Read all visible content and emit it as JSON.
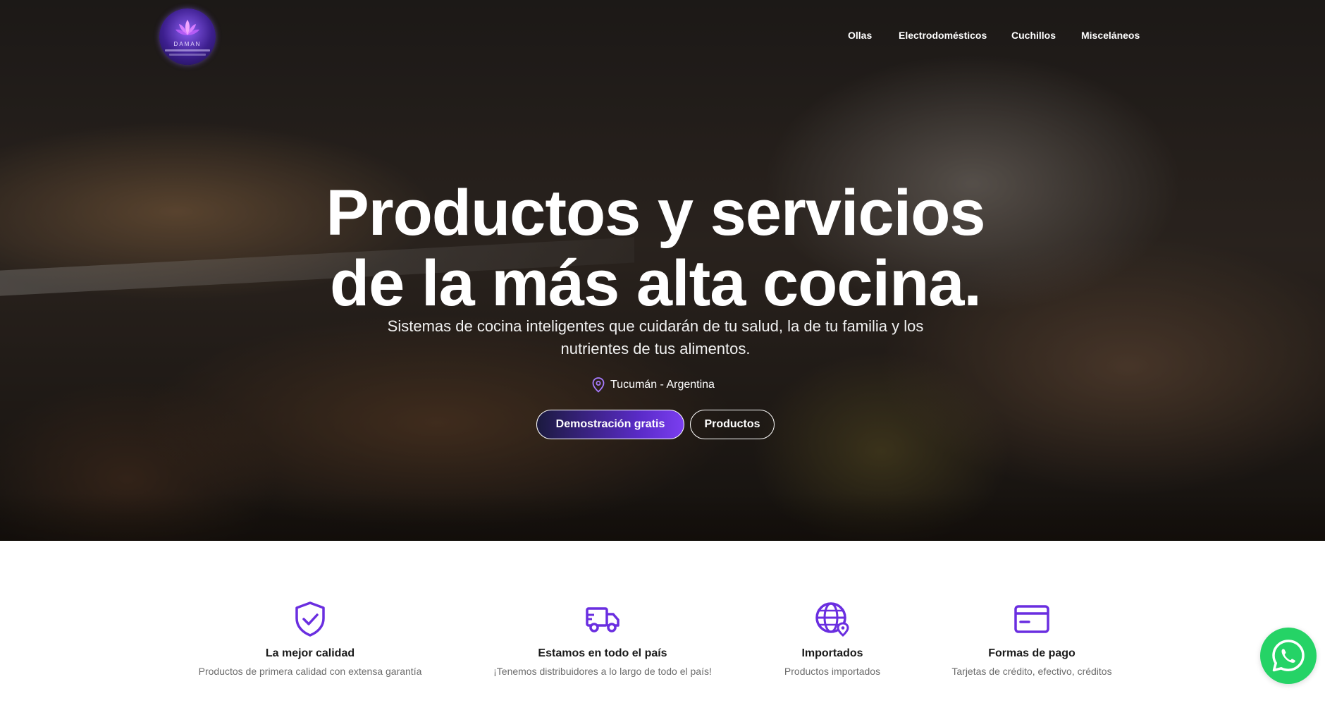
{
  "brand": {
    "logo_text": "DAMAN",
    "accent_color": "#6a2ee0"
  },
  "nav": {
    "items": [
      {
        "label": "Ollas"
      },
      {
        "label": "Electrodomésticos"
      },
      {
        "label": "Cuchillos"
      },
      {
        "label": "Misceláneos"
      }
    ]
  },
  "hero": {
    "headline_line1": "Productos y servicios",
    "headline_line2": "de la más alta cocina.",
    "subtext_line1": "Sistemas de cocina inteligentes que cuidarán de tu salud, la de tu familia y los",
    "subtext_line2": "nutrientes de tus alimentos.",
    "location": "Tucumán - Argentina",
    "location_icon": "map-pin-icon",
    "primary_button": "Demostración gratis",
    "secondary_button": "Productos"
  },
  "features": [
    {
      "icon": "shield-check-icon",
      "title": "La mejor calidad",
      "description": "Productos de primera calidad con extensa garantía"
    },
    {
      "icon": "truck-icon",
      "title": "Estamos en todo el país",
      "description": "¡Tenemos distribuidores a lo largo de todo el país!"
    },
    {
      "icon": "globe-location-icon",
      "title": "Importados",
      "description": "Productos importados"
    },
    {
      "icon": "credit-card-icon",
      "title": "Formas de pago",
      "description": "Tarjetas de crédito, efectivo, créditos"
    }
  ],
  "floating": {
    "whatsapp_icon": "whatsapp-icon",
    "whatsapp_color": "#25d366"
  }
}
